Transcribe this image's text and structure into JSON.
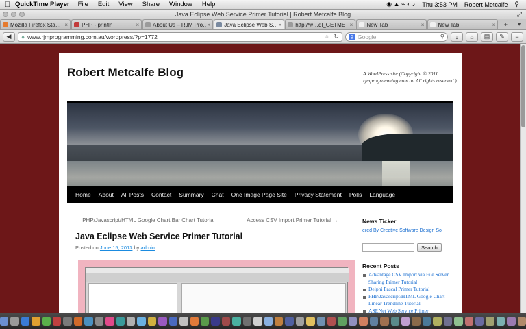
{
  "menubar": {
    "app_name": "QuickTime Player",
    "items": [
      "File",
      "Edit",
      "View",
      "Share",
      "Window",
      "Help"
    ],
    "status": {
      "time": "Thu 3:53 PM",
      "user": "Robert Metcalfe"
    }
  },
  "window": {
    "title": "Java Eclipse Web Service Primer Tutorial | Robert Metcalfe Blog"
  },
  "tabs": [
    {
      "label": "Mozilla Firefox Sta…",
      "color": "#e57a2e"
    },
    {
      "label": "PHP - println",
      "color": "#c23b3b"
    },
    {
      "label": "About Us – RJM Pro…",
      "color": "#9b9b9b"
    },
    {
      "label": "Java Eclipse Web S…",
      "color": "#7a8aa0",
      "active": true
    },
    {
      "label": "http://w…dl_GETME",
      "color": "#9b9b9b"
    },
    {
      "label": "New Tab",
      "color": "#f0f0f0"
    },
    {
      "label": "New Tab",
      "color": "#f0f0f0"
    }
  ],
  "toolbar": {
    "url": "www.rjmprogramming.com.au/wordpress/?p=1772",
    "search_placeholder": "Google"
  },
  "site": {
    "title": "Robert Metcalfe Blog",
    "description": "A WordPress site (Copyright © 2011 rjmprogramming.com.au All rights reserved.)",
    "nav": [
      "Home",
      "About",
      "All Posts",
      "Contact",
      "Summary",
      "Chat",
      "One Image Page Site",
      "Privacy Statement",
      "Polls",
      "Language"
    ]
  },
  "post": {
    "prev_link": "← PHP/Javascript/HTML Google Chart Bar Chart Tutorial",
    "next_link": "Access CSV Import Primer Tutorial →",
    "title": "Java Eclipse Web Service Primer Tutorial",
    "meta_prefix": "Posted on",
    "date": "June 15, 2013",
    "meta_by": "by",
    "author": "admin"
  },
  "sidebar": {
    "news_title": "News Ticker",
    "news_text": "ered By Creative Software Design So",
    "search_button": "Search",
    "recent_title": "Recent Posts",
    "recent_posts": [
      "Advantage CSV Import via File Server Sharing Primer Tutorial",
      "Delphi Pascal Primer Tutorial",
      "PHP/Javascript/HTML Google Chart Linear Trendline Tutorial",
      "ASP.Net Web Service Primer"
    ]
  },
  "colors": {
    "background": "#6d1718",
    "accent_link": "#1b6fd0",
    "nav_bar": "#000000"
  }
}
